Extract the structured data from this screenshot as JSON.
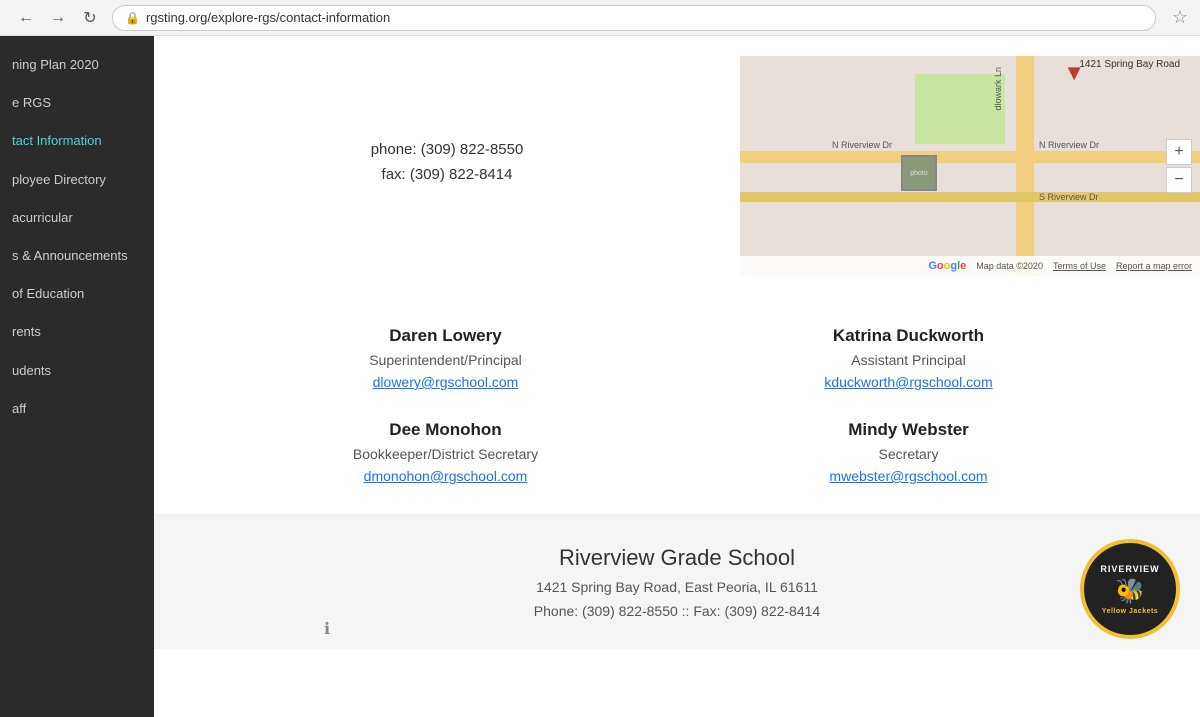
{
  "browser": {
    "url": "rgsting.org/explore-rgs/contact-information",
    "star_icon": "★"
  },
  "sidebar": {
    "items": [
      {
        "id": "learning-plan",
        "label": "ning Plan 2020",
        "active": false
      },
      {
        "id": "explore-rgs",
        "label": "e RGS",
        "active": false
      },
      {
        "id": "contact-info",
        "label": "tact Information",
        "active": true
      },
      {
        "id": "employee-dir",
        "label": "ployee Directory",
        "active": false
      },
      {
        "id": "extracurricular",
        "label": "acurricular",
        "active": false
      },
      {
        "id": "news",
        "label": "s & Announcements",
        "active": false
      },
      {
        "id": "education",
        "label": "of Education",
        "active": false
      },
      {
        "id": "parents",
        "label": "rents",
        "active": false
      },
      {
        "id": "students",
        "label": "udents",
        "active": false
      },
      {
        "id": "staff",
        "label": "aff",
        "active": false
      }
    ]
  },
  "contact": {
    "phone_label": "phone: (309) 822-8550",
    "fax_label": "fax: (309) 822-8414"
  },
  "map": {
    "address_label": "1421 Spring Bay Road",
    "zoom_in": "+",
    "zoom_out": "−",
    "data_label": "Map data ©2020",
    "terms_label": "Terms of Use",
    "report_label": "Report a map error"
  },
  "staff": [
    {
      "name": "Daren Lowery",
      "title": "Superintendent/Principal",
      "email": "dlowery@rgschool.com"
    },
    {
      "name": "Katrina Duckworth",
      "title": "Assistant Principal",
      "email": "kduckworth@rgschool.com"
    },
    {
      "name": "Dee Monohon",
      "title": "Bookkeeper/District Secretary",
      "email": "dmonohon@rgschool.com"
    },
    {
      "name": "Mindy Webster",
      "title": "Secretary",
      "email": "mwebster@rgschool.com"
    }
  ],
  "footer": {
    "school_name": "Riverview Grade School",
    "address": "1421 Spring Bay Road, East Peoria, IL 61611",
    "phone_fax": "Phone: (309) 822-8550 :: Fax: (309) 822-8414",
    "logo_top": "RIVERVIEW",
    "logo_bottom": "Yellow Jackets",
    "logo_bee": "🐝"
  },
  "icons": {
    "lock": "🔒",
    "star": "☆",
    "info": "ℹ",
    "back": "←",
    "forward": "→",
    "refresh": "↻",
    "map_pin": "▼"
  }
}
